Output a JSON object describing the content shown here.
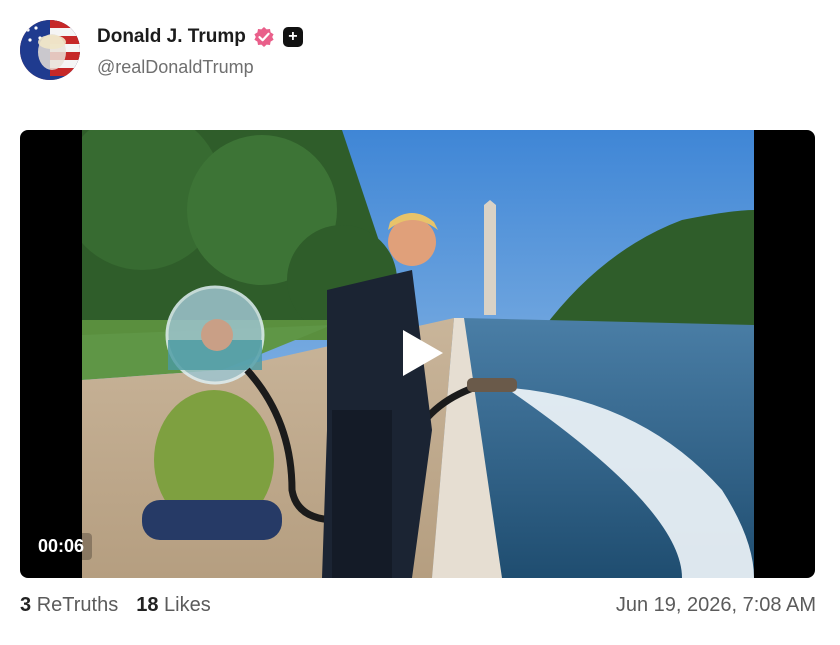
{
  "author": {
    "display_name": "Donald J. Trump",
    "handle": "@realDonaldTrump",
    "avatar_icon": "flag-portrait-avatar",
    "verified_icon": "verified-badge-icon",
    "verified_color": "#e95f8a",
    "plus_badge": "+"
  },
  "media": {
    "type": "video",
    "timestamp": "00:06",
    "play_icon": "play-icon"
  },
  "stats": {
    "retruths_count": "3",
    "retruths_label": "ReTruths",
    "likes_count": "18",
    "likes_label": "Likes"
  },
  "posted_at": "Jun 19, 2026, 7:08 AM",
  "colors": {
    "name_text": "#1c1c1c",
    "muted_text": "#5b5b5b",
    "video_letterbox": "#000000"
  }
}
